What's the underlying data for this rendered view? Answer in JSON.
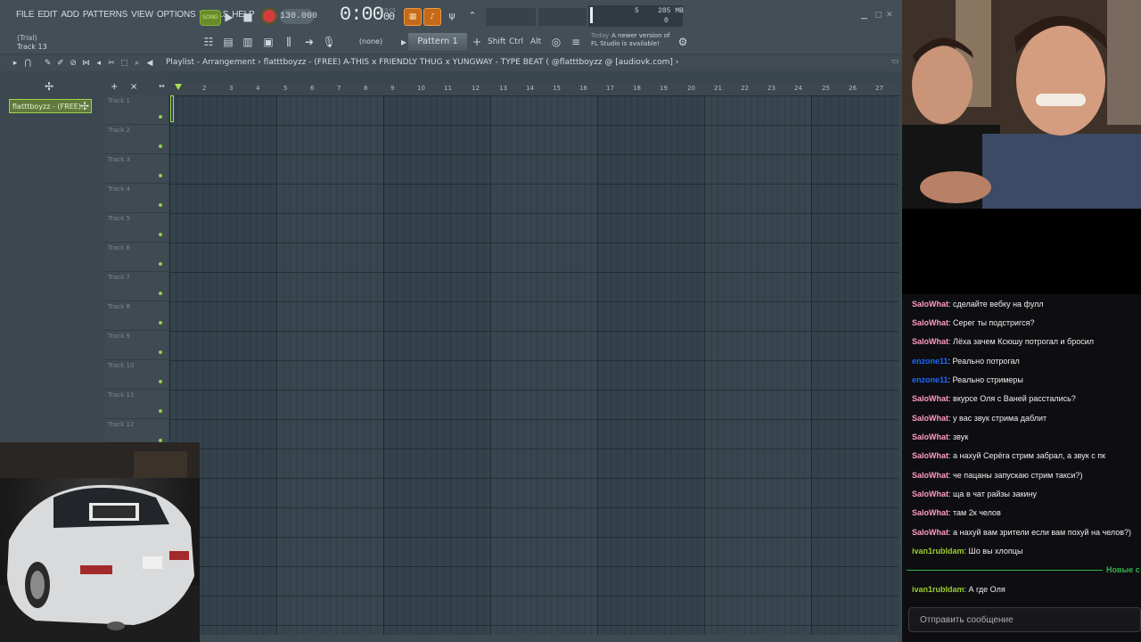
{
  "fl": {
    "menu": [
      "FILE",
      "EDIT",
      "ADD",
      "PATTERNS",
      "VIEW",
      "OPTIONS",
      "TOOLS",
      "HELP"
    ],
    "song_mode_label": "SONG",
    "tempo": "130.000",
    "time": "0:00",
    "time_small": "00",
    "time_unit": "M:S:CS",
    "cpu_value": "5",
    "ram_value": "285 MB",
    "voices": "0",
    "trial": "(Trial)",
    "hint_text": "Track 13",
    "none_label": "(none)",
    "pattern_label": "Pattern 1",
    "mod_keys": [
      "Shift",
      "Ctrl",
      "Alt"
    ],
    "news_date": "Today",
    "news_text_1": "A newer version of",
    "news_text_2": "FL Studio is available!",
    "playlist_breadcrumb": "Playlist - Arrangement  ›  flatttboyzz - (FREE) A-THIS x FRIENDLY THUG x YUNGWAY - TYPE BEAT ( @flatttboyzz @ [audiovk.com]  ›",
    "pattern_item": "flatttboyzz - (FREE)...",
    "tracks": [
      "Track 1",
      "Track 2",
      "Track 3",
      "Track 4",
      "Track 5",
      "Track 6",
      "Track 7",
      "Track 8",
      "Track 9",
      "Track 10",
      "Track 11",
      "Track 12"
    ],
    "ruler": [
      "2",
      "3",
      "4",
      "5",
      "6",
      "7",
      "8",
      "9",
      "10",
      "11",
      "12",
      "13",
      "14",
      "15",
      "16",
      "17",
      "18",
      "19",
      "20",
      "21",
      "22",
      "23",
      "24",
      "25",
      "26",
      "27"
    ]
  },
  "chat": {
    "messages": [
      {
        "user": "SaloWhat",
        "color": "#ff9bc2",
        "text": "сделайте вебку на фулл"
      },
      {
        "user": "SaloWhat",
        "color": "#ff9bc2",
        "text": "Серег ты подстригся?"
      },
      {
        "user": "SaloWhat",
        "color": "#ff9bc2",
        "text": "Лёха зачем Ксюшу потрогал и бросил"
      },
      {
        "user": "enzone11",
        "color": "#1e69ff",
        "text": "Реально потрогал"
      },
      {
        "user": "enzone11",
        "color": "#1e69ff",
        "text": "Реально стримеры"
      },
      {
        "user": "SaloWhat",
        "color": "#ff9bc2",
        "text": "вкурсе Оля с Ваней расстались?"
      },
      {
        "user": "SaloWhat",
        "color": "#ff9bc2",
        "text": "у вас звук стрима даблит"
      },
      {
        "user": "SaloWhat",
        "color": "#ff9bc2",
        "text": "звук"
      },
      {
        "user": "SaloWhat",
        "color": "#ff9bc2",
        "text": "а нахуй Серёга стрим забрал, а звук с пк"
      },
      {
        "user": "SaloWhat",
        "color": "#ff9bc2",
        "text": "че пацаны запускаю стрим такси?)"
      },
      {
        "user": "SaloWhat",
        "color": "#ff9bc2",
        "text": "ща в чат райзы закину"
      },
      {
        "user": "SaloWhat",
        "color": "#ff9bc2",
        "text": "там 2к челов"
      },
      {
        "user": "SaloWhat",
        "color": "#ff9bc2",
        "text": "а нахуй вам зрители если вам похуй на челов?)"
      },
      {
        "user": "ivan1rubldam",
        "color": "#9acd32",
        "text": "Шо вы хлопцы"
      }
    ],
    "divider_text": "Новые с",
    "after_divider": [
      {
        "user": "ivan1rubldam",
        "color": "#9acd32",
        "text": "А где Оля"
      }
    ],
    "input_placeholder": "Отправить сообщение"
  }
}
